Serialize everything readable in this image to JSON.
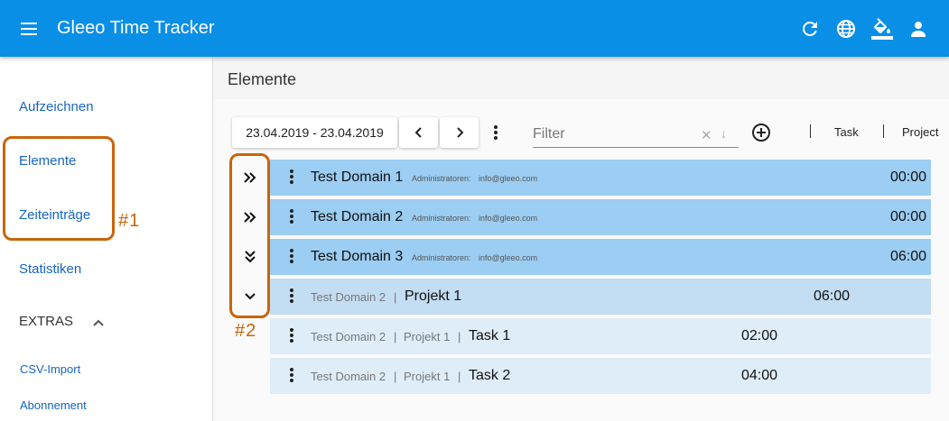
{
  "app": {
    "title": "Gleeo Time Tracker"
  },
  "topbar_icons": [
    "refresh-icon",
    "globe-icon",
    "paint-bucket-icon",
    "person-icon"
  ],
  "sidebar": {
    "items": [
      {
        "label": "Aufzeichnen"
      },
      {
        "label": "Elemente"
      },
      {
        "label": "Zeiteinträge"
      },
      {
        "label": "Statistiken"
      }
    ],
    "extras_label": "EXTRAS",
    "extras_items": [
      {
        "label": "CSV-Import"
      },
      {
        "label": "Abonnement"
      }
    ]
  },
  "annotations": {
    "label_1": "#1",
    "label_2": "#2"
  },
  "main": {
    "title": "Elemente",
    "date_range": "23.04.2019 - 23.04.2019",
    "filter_placeholder": "Filter",
    "columns": [
      "Task",
      "Project"
    ]
  },
  "rows": [
    {
      "type": "domain",
      "name": "Test Domain 1",
      "meta_label": "Administratoren:",
      "meta_value": "info@gleeo.com",
      "time": "00:00",
      "expand_icon": "double-chevron-right-icon"
    },
    {
      "type": "domain",
      "name": "Test Domain 2",
      "meta_label": "Administratoren:",
      "meta_value": "info@gleeo.com",
      "time": "00:00",
      "expand_icon": "double-chevron-right-icon"
    },
    {
      "type": "domain",
      "name": "Test Domain 3",
      "meta_label": "Administratoren:",
      "meta_value": "info@gleeo.com",
      "time": "06:00",
      "expand_icon": "double-chevron-down-icon"
    },
    {
      "type": "project",
      "domain": "Test Domain 2",
      "name": "Projekt 1",
      "time": "06:00",
      "expand_icon": "chevron-down-icon"
    },
    {
      "type": "task",
      "domain": "Test Domain 2",
      "project": "Projekt 1",
      "name": "Task 1",
      "time": "02:00"
    },
    {
      "type": "task",
      "domain": "Test Domain 2",
      "project": "Projekt 1",
      "name": "Task 2",
      "time": "04:00"
    }
  ],
  "colors": {
    "appbar": "#0a8fe6",
    "link": "#1565c0",
    "callout": "#c8650a",
    "domain_row": "#9ccdf2",
    "project_row": "#c3ddf3",
    "task_row": "#deedf8"
  }
}
